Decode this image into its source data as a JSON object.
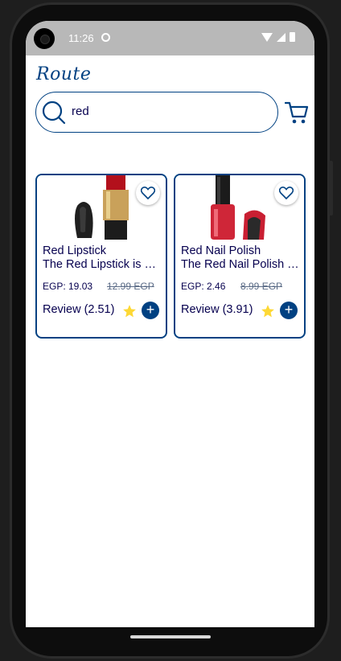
{
  "status_bar": {
    "time": "11:26"
  },
  "app": {
    "logo_text": "Route"
  },
  "search": {
    "value": "red"
  },
  "products": [
    {
      "title": "Red Lipstick",
      "description": "The Red Lipstick is a classic",
      "price": "EGP: 19.03",
      "old_price": "12.99 EGP",
      "review": "Review (2.51)"
    },
    {
      "title": "Red Nail Polish",
      "description": "The Red Nail Polish offers",
      "price": "EGP: 2.46",
      "old_price": "8.99 EGP",
      "review": "Review (3.91)"
    }
  ],
  "colors": {
    "primary": "#004182",
    "text": "#06004f",
    "star": "#fdd835"
  }
}
